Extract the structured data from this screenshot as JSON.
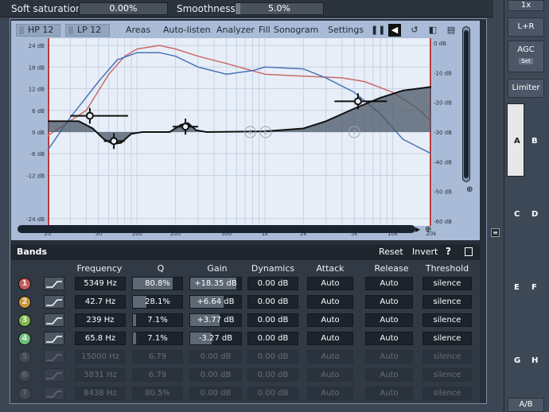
{
  "top": {
    "soft_label": "Soft saturation",
    "soft_value": "0.00%",
    "smooth_label": "Smoothness",
    "smooth_value": "5.0%",
    "smooth_fill": 0.05
  },
  "toolbar": {
    "hp": "HP 12",
    "lp": "LP 12",
    "items": [
      "Areas",
      "Auto-listen",
      "Analyzer",
      "Fill",
      "Sonogram",
      "Settings"
    ]
  },
  "graph": {
    "left_ticks": [
      "24 dB",
      "18 dB",
      "12 dB",
      "6 dB",
      "0 dB",
      "-6 dB",
      "-12 dB",
      "-24 dB"
    ],
    "right_ticks": [
      "0 dB",
      "-10 dB",
      "-20 dB",
      "-30 dB",
      "-40 dB",
      "-50 dB",
      "-60 dB"
    ],
    "freq_ticks": [
      "20",
      "50",
      "100",
      "200",
      "500",
      "1k",
      "2k",
      "5k",
      "10k",
      "20k"
    ],
    "faint_band_numbers": [
      "5",
      "6",
      "7"
    ],
    "bands": [
      {
        "freq_hz": 5349,
        "gain_db": 18.35
      },
      {
        "freq_hz": 42.7,
        "gain_db": 6.64
      },
      {
        "freq_hz": 239,
        "gain_db": 3.77
      },
      {
        "freq_hz": 65.8,
        "gain_db": -3.27
      }
    ]
  },
  "bands": {
    "title": "Bands",
    "reset": "Reset",
    "invert": "Invert",
    "help": "?",
    "columns": [
      "Frequency",
      "Q",
      "Gain",
      "Dynamics",
      "Attack",
      "Release",
      "Threshold"
    ],
    "rows": [
      {
        "num": "1",
        "freq": "5349 Hz",
        "q": "80.8%",
        "q_level": 0.808,
        "gain": "+18.35 dB",
        "gain_level": 0.9,
        "dyn": "0.00 dB",
        "attack": "Auto",
        "release": "Auto",
        "threshold": "silence",
        "color": "#c65a5a"
      },
      {
        "num": "2",
        "freq": "42.7 Hz",
        "q": "28.1%",
        "q_level": 0.281,
        "gain": "+6.64 dB",
        "gain_level": 0.66,
        "dyn": "0.00 dB",
        "attack": "Auto",
        "release": "Auto",
        "threshold": "silence",
        "color": "#c9953a"
      },
      {
        "num": "3",
        "freq": "239 Hz",
        "q": "7.1%",
        "q_level": 0.071,
        "gain": "+3.77 dB",
        "gain_level": 0.58,
        "dyn": "0.00 dB",
        "attack": "Auto",
        "release": "Auto",
        "threshold": "silence",
        "color": "#7fba4a"
      },
      {
        "num": "4",
        "freq": "65.8 Hz",
        "q": "7.1%",
        "q_level": 0.071,
        "gain": "-3.27 dB",
        "gain_level": 0.42,
        "dyn": "0.00 dB",
        "attack": "Auto",
        "release": "Auto",
        "threshold": "silence",
        "color": "#6cc07a"
      },
      {
        "num": "5",
        "freq": "15000 Hz",
        "q": "6.79",
        "q_level": 0,
        "gain": "0.00 dB",
        "gain_level": 0,
        "dyn": "0.00 dB",
        "attack": "Auto",
        "release": "Auto",
        "threshold": "silence",
        "color": "#777"
      },
      {
        "num": "6",
        "freq": "3831 Hz",
        "q": "6.79",
        "q_level": 0,
        "gain": "0.00 dB",
        "gain_level": 0,
        "dyn": "0.00 dB",
        "attack": "Auto",
        "release": "Auto",
        "threshold": "silence",
        "color": "#777"
      },
      {
        "num": "7",
        "freq": "8438 Hz",
        "q": "80.5%",
        "q_level": 0,
        "gain": "0.00 dB",
        "gain_level": 0,
        "dyn": "0.00 dB",
        "attack": "Auto",
        "release": "Auto",
        "threshold": "silence",
        "color": "#777"
      }
    ]
  },
  "right": {
    "btn1": "1x",
    "btn2": "L+R",
    "agc": "AGC",
    "set": "Set",
    "limiter": "Limiter",
    "slots": [
      "A",
      "B",
      "C",
      "D",
      "E",
      "F",
      "G",
      "H"
    ],
    "ab": "A/B"
  },
  "icons": [
    "pause-icon",
    "speaker-icon",
    "undo-icon",
    "copy-icon",
    "paste-icon",
    "zoom-in-icon",
    "zoom-out-icon",
    "scroll-left-icon",
    "scroll-right-icon",
    "collapse-icon"
  ]
}
